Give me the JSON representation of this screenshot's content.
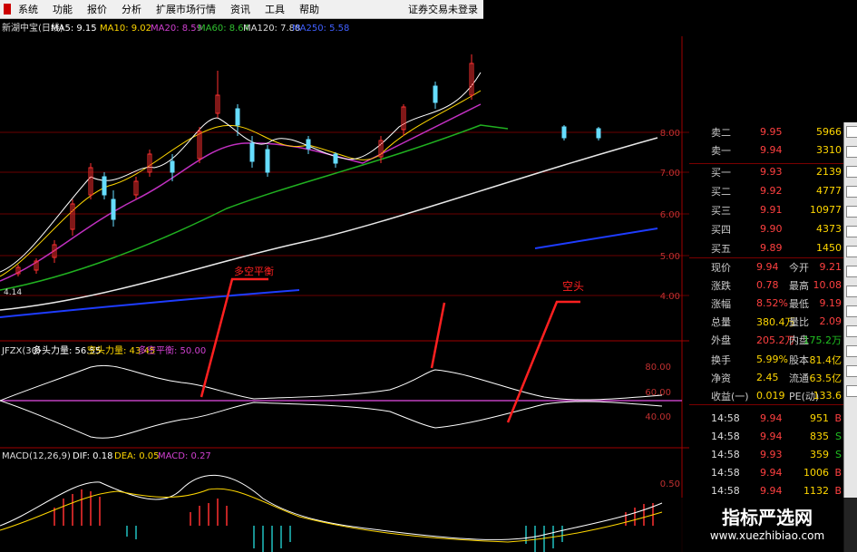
{
  "menu": {
    "items": [
      "系统",
      "功能",
      "报价",
      "分析",
      "扩展市场行情",
      "资讯",
      "工具",
      "帮助"
    ],
    "status": "证券交易未登录"
  },
  "main_chart": {
    "title": "新湖中宝(日线)",
    "ma5": "MA5: 9.15",
    "ma10": "MA10: 9.02",
    "ma20": "MA20: 8.59",
    "ma60": "MA60: 8.64",
    "ma120": "MA120: 7.88",
    "ma250": "MA250: 5.58",
    "y_labels": [
      "8.00",
      "7.00",
      "6.00",
      "5.00",
      "4.00"
    ],
    "low_price": "4.14"
  },
  "indicator": {
    "header": "JFZX(30)",
    "long_force": "多头力量: 56.55",
    "short_force": "空头力量: 43.45",
    "balance": "多空平衡: 50.00",
    "y_labels": [
      "80.00",
      "60.00",
      "40.00"
    ],
    "annotation_balance": "多空平衡",
    "annotation_short": "空头"
  },
  "macd": {
    "header": "MACD(12,26,9)",
    "dif": "DIF: 0.18",
    "dea": "DEA: 0.05",
    "macd": "MACD: 0.27",
    "y_label": "0.50"
  },
  "quotes": {
    "book": [
      {
        "label": "卖二",
        "price": "9.95",
        "vol": "5966"
      },
      {
        "label": "卖一",
        "price": "9.94",
        "vol": "3310"
      },
      {
        "label": "买一",
        "price": "9.93",
        "vol": "2139"
      },
      {
        "label": "买二",
        "price": "9.92",
        "vol": "4777"
      },
      {
        "label": "买三",
        "price": "9.91",
        "vol": "10977"
      },
      {
        "label": "买四",
        "price": "9.90",
        "vol": "4373"
      },
      {
        "label": "买五",
        "price": "9.89",
        "vol": "1450"
      }
    ],
    "stats": [
      {
        "label": "现价",
        "v1": "9.94",
        "l2": "今开",
        "v2": "9.21"
      },
      {
        "label": "涨跌",
        "v1": "0.78",
        "l2": "最高",
        "v2": "10.08"
      },
      {
        "label": "涨幅",
        "v1": "8.52%",
        "l2": "最低",
        "v2": "9.19"
      },
      {
        "label": "总量",
        "v1": "380.4万",
        "l2": "量比",
        "v2": "2.09"
      },
      {
        "label": "外盘",
        "v1": "205.2万",
        "l2": "内盘",
        "v2": "175.2万"
      },
      {
        "label": "换手",
        "v1": "5.99%",
        "l2": "股本",
        "v2": "81.4亿"
      },
      {
        "label": "净资",
        "v1": "2.45",
        "l2": "流通",
        "v2": "63.5亿"
      },
      {
        "label": "收益(一)",
        "v1": "0.019",
        "l2": "PE(动)",
        "v2": "133.6"
      }
    ],
    "ticks": [
      {
        "time": "14:58",
        "price": "9.94",
        "vol": "951",
        "side": "B"
      },
      {
        "time": "14:58",
        "price": "9.94",
        "vol": "835",
        "side": "S"
      },
      {
        "time": "14:58",
        "price": "9.93",
        "vol": "359",
        "side": "S"
      },
      {
        "time": "14:58",
        "price": "9.94",
        "vol": "1006",
        "side": "B"
      },
      {
        "time": "14:58",
        "price": "9.94",
        "vol": "1132",
        "side": "B"
      }
    ]
  },
  "watermark": {
    "line1": "指标严选网",
    "line2": "www.xuezhibiao.com"
  }
}
